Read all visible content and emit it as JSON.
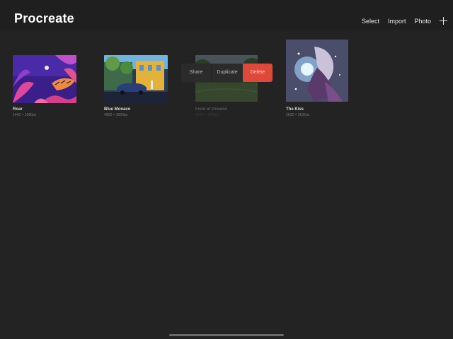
{
  "app": {
    "title": "Procreate"
  },
  "toolbar": {
    "select_label": "Select",
    "import_label": "Import",
    "photo_label": "Photo",
    "add_icon": "plus-icon"
  },
  "gallery": {
    "artworks": [
      {
        "title": "Roar",
        "size": "1440 × 1080px"
      },
      {
        "title": "Blue Monaco",
        "size": "4000 × 3000px"
      },
      {
        "title": "Field of Dreams",
        "size": "4000 × 3000px"
      },
      {
        "title": "The Kiss",
        "size": "2632 × 2632px"
      }
    ]
  },
  "action_menu": {
    "share_label": "Share",
    "duplicate_label": "Duplicate",
    "delete_label": "Delete",
    "delete_color": "#e0493a"
  },
  "colors": {
    "background": "#232323",
    "header": "#1f1f1f"
  }
}
